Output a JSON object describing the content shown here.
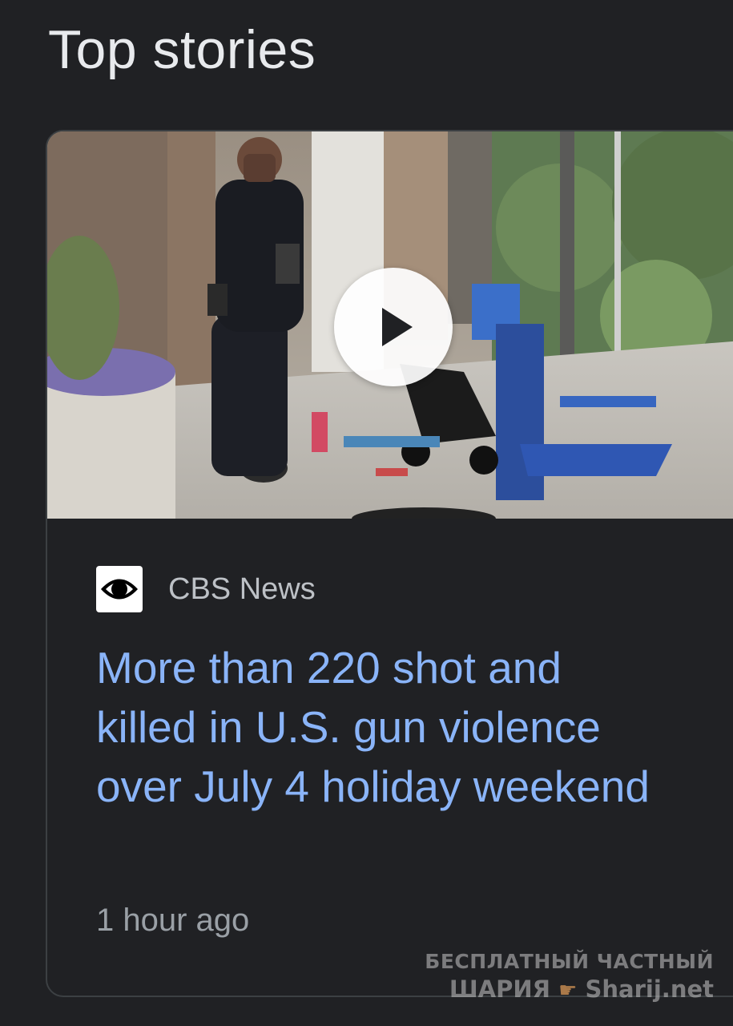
{
  "section": {
    "title": "Top stories"
  },
  "story": {
    "source": "CBS News",
    "source_logo_icon": "cbs-eye-icon",
    "headline": "More than 220 shot and killed in U.S. gun violence over July 4 holiday weekend",
    "time": "1 hour ago",
    "media": {
      "type": "video",
      "play_icon": "play-icon"
    }
  },
  "watermark": {
    "line1": "БЕСПЛАТНЫЙ ЧАСТНЫЙ",
    "line2_left": "ШАРИЯ",
    "line2_right": "Sharij.net"
  },
  "colors": {
    "background": "#202124",
    "headline_link": "#8ab4f8",
    "secondary_text": "#9aa0a6",
    "card_border": "#3c4043"
  }
}
